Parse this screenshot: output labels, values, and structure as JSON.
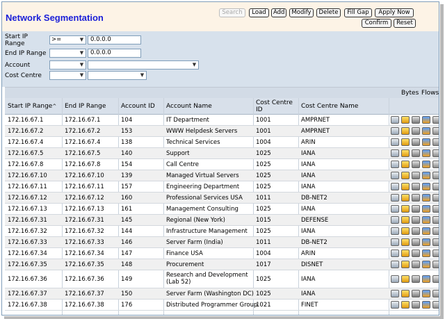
{
  "header": {
    "title": "Network Segmentation",
    "buttons": {
      "search": "Search",
      "load": "Load",
      "add": "Add",
      "modify": "Modify",
      "delete": "Delete",
      "fill_gap": "Fill Gap",
      "apply_now": "Apply Now",
      "confirm": "Confirm",
      "reset": "Reset"
    }
  },
  "filters": {
    "start_ip_label_1": "Start IP",
    "start_ip_label_2": "Range",
    "start_ip_operator": ">=",
    "start_ip_value": "0.0.0.0",
    "end_ip_label": "End IP Range",
    "end_ip_operator": "",
    "end_ip_value": "0.0.0.0",
    "account_label": "Account",
    "account_operator": "",
    "account_value": "",
    "cost_centre_label": "Cost Centre",
    "cost_centre_operator": "",
    "cost_centre_value": ""
  },
  "table": {
    "group_headers": {
      "bytes": "Bytes",
      "flows": "Flows"
    },
    "columns": {
      "start_ip": "Start IP Range",
      "sort_indicator": "^",
      "end_ip": "End IP Range",
      "account_id": "Account ID",
      "account_name": "Account Name",
      "cost_centre_id_1": "Cost Centre",
      "cost_centre_id_2": "ID",
      "cost_centre_name": "Cost Centre Name"
    },
    "row_icons": [
      "details-icon",
      "bytes-chart-icon",
      "edit-icon",
      "flows-chart-icon",
      "delete-icon"
    ],
    "rows": [
      [
        "172.16.67.1",
        "172.16.67.1",
        "104",
        "IT Department",
        "1001",
        "AMPRNET"
      ],
      [
        "172.16.67.2",
        "172.16.67.2",
        "153",
        "WWW Helpdesk Servers",
        "1001",
        "AMPRNET"
      ],
      [
        "172.16.67.4",
        "172.16.67.4",
        "138",
        "Technical Services",
        "1004",
        "ARIN"
      ],
      [
        "172.16.67.5",
        "172.16.67.5",
        "140",
        "Support",
        "1025",
        "IANA"
      ],
      [
        "172.16.67.8",
        "172.16.67.8",
        "154",
        "Call Centre",
        "1025",
        "IANA"
      ],
      [
        "172.16.67.10",
        "172.16.67.10",
        "139",
        "Managed Virtual Servers",
        "1025",
        "IANA"
      ],
      [
        "172.16.67.11",
        "172.16.67.11",
        "157",
        "Engineering Department",
        "1025",
        "IANA"
      ],
      [
        "172.16.67.12",
        "172.16.67.12",
        "160",
        "Professional Services USA",
        "1011",
        "DB-NET2"
      ],
      [
        "172.16.67.13",
        "172.16.67.13",
        "161",
        "Management Consulting",
        "1025",
        "IANA"
      ],
      [
        "172.16.67.31",
        "172.16.67.31",
        "145",
        "Regional (New York)",
        "1015",
        "DEFENSE"
      ],
      [
        "172.16.67.32",
        "172.16.67.32",
        "144",
        "Infrastructure Management",
        "1025",
        "IANA"
      ],
      [
        "172.16.67.33",
        "172.16.67.33",
        "146",
        "Server Farm (India)",
        "1011",
        "DB-NET2"
      ],
      [
        "172.16.67.34",
        "172.16.67.34",
        "147",
        "Finance USA",
        "1004",
        "ARIN"
      ],
      [
        "172.16.67.35",
        "172.16.67.35",
        "148",
        "Procurement",
        "1017",
        "DISNET"
      ],
      [
        "172.16.67.36",
        "172.16.67.36",
        "149",
        "Research and Development (Lab 52)",
        "1025",
        "IANA"
      ],
      [
        "172.16.67.37",
        "172.16.67.37",
        "150",
        "Server Farm (Washington DC)",
        "1025",
        "IANA"
      ],
      [
        "172.16.67.38",
        "172.16.67.38",
        "176",
        "Distributed Programmer Group",
        "1021",
        "FINET"
      ]
    ]
  },
  "colors": {
    "title": "#1c20d8",
    "header_bg": "#fdf3e6",
    "filter_bg": "#d7e1ec",
    "table_header_bg": "#d8e0ea"
  }
}
